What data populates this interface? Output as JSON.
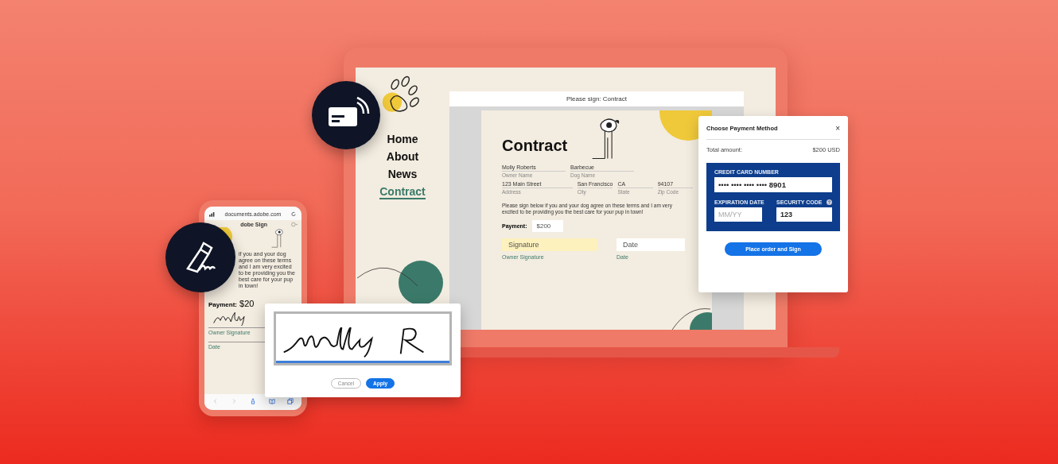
{
  "laptop": {
    "sidebar": {
      "nav": [
        {
          "label": "Home",
          "selected": false
        },
        {
          "label": "About",
          "selected": false
        },
        {
          "label": "News",
          "selected": false
        },
        {
          "label": "Contract",
          "selected": true
        }
      ]
    },
    "document": {
      "title_bar": "Please sign: Contract",
      "heading": "Contract",
      "field_rows": [
        [
          {
            "value": "Molly Roberts",
            "label": "Owner Name"
          },
          {
            "value": "Barbecue",
            "label": "Dog Name"
          }
        ],
        [
          {
            "value": "123 Main Street",
            "label": "Address"
          },
          {
            "value": "San Francisco",
            "label": "City"
          },
          {
            "value": "CA",
            "label": "State"
          },
          {
            "value": "94107",
            "label": "Zip Code"
          }
        ]
      ],
      "message": "Please sign below if you and your dog agree on these terms and I am very excited to be providing you the best care for your pup in town!",
      "payment": {
        "label": "Payment:",
        "value": "$200"
      },
      "signature_field": {
        "placeholder": "Signature",
        "label": "Owner Signature"
      },
      "date_field": {
        "placeholder": "Date",
        "label": "Date"
      }
    }
  },
  "payment_dialog": {
    "title": "Choose Payment Method",
    "close": "×",
    "total_label": "Total amount:",
    "total_value": "$200 USD",
    "card_number_label": "CREDIT CARD NUMBER",
    "card_number": "•••• •••• •••• •••• **8901**",
    "expiration_label": "EXPIRATION DATE",
    "expiration_placeholder": "MM/YY",
    "security_label": "SECURITY CODE",
    "security_value": "123",
    "button": "Place order and Sign"
  },
  "phone": {
    "url": "documents.adobe.com",
    "app_title": "dobe Sign",
    "message": "if you and your dog agree on these terms and I am very excited to be providing you the best care for your pup in town!",
    "payment_label": "Payment:",
    "payment_value": "$20",
    "signature_label": "Owner Signature",
    "date_label": "Date"
  },
  "signature_pad": {
    "buttons": [
      {
        "label": "Cancel",
        "primary": false
      },
      {
        "label": "Apply",
        "primary": true
      }
    ]
  }
}
